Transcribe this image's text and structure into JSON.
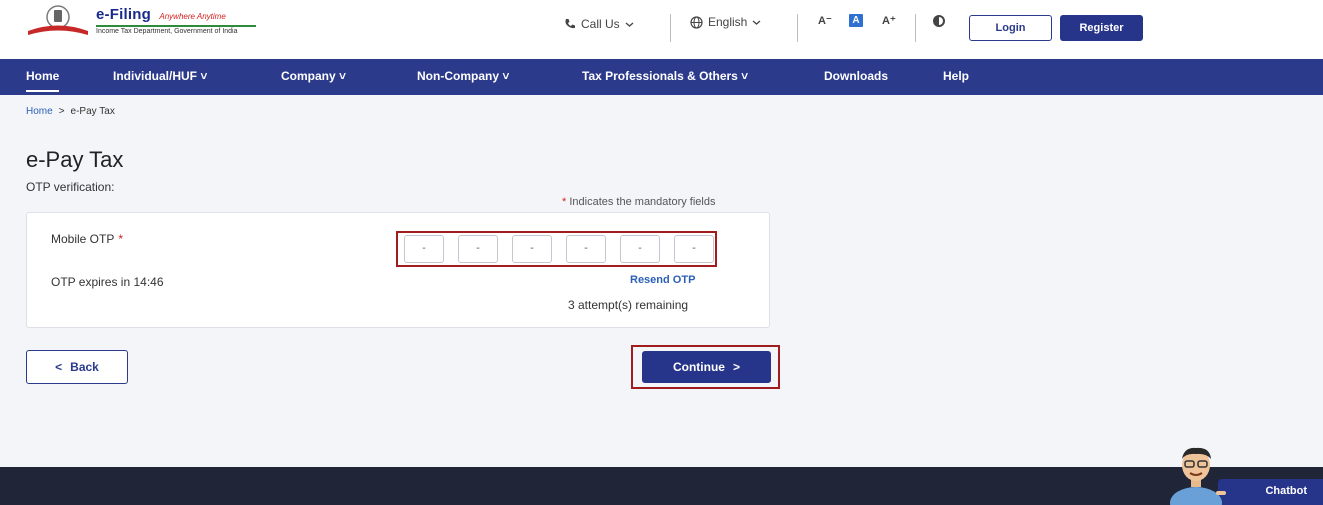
{
  "header": {
    "brand_title": "e-Filing",
    "brand_tagline": "Anywhere Anytime",
    "brand_subtitle": "Income Tax Department, Government of India",
    "call_us": "Call Us",
    "language": "English",
    "font_decrease": "A⁻",
    "font_default": "A",
    "font_increase": "A⁺",
    "login": "Login",
    "register": "Register"
  },
  "nav": {
    "items": [
      {
        "label": "Home"
      },
      {
        "label": "Individual/HUF ˅"
      },
      {
        "label": "Company ˅"
      },
      {
        "label": "Non-Company ˅"
      },
      {
        "label": "Tax Professionals & Others ˅"
      },
      {
        "label": "Downloads"
      },
      {
        "label": "Help"
      }
    ]
  },
  "breadcrumb": {
    "home": "Home",
    "separator": ">",
    "current": "e-Pay Tax"
  },
  "page": {
    "title": "e-Pay Tax",
    "subtitle": "OTP verification:",
    "mandatory_star": "*",
    "mandatory_note": "Indicates the mandatory fields"
  },
  "otp": {
    "label": "Mobile OTP",
    "required_star": "*",
    "digits": [
      "-",
      "-",
      "-",
      "-",
      "-",
      "-"
    ],
    "expires": "OTP expires in 14:46",
    "resend": "Resend OTP",
    "attempts": "3 attempt(s) remaining"
  },
  "actions": {
    "back_chevron": "<",
    "back": "Back",
    "continue": "Continue",
    "continue_chevron": ">"
  },
  "chatbot": {
    "label": "Chatbot"
  },
  "colors": {
    "primary": "#26348a",
    "nav": "#2c3a8c",
    "highlight": "#a11c1c",
    "link": "#2c5fb8",
    "footer": "#202538"
  }
}
